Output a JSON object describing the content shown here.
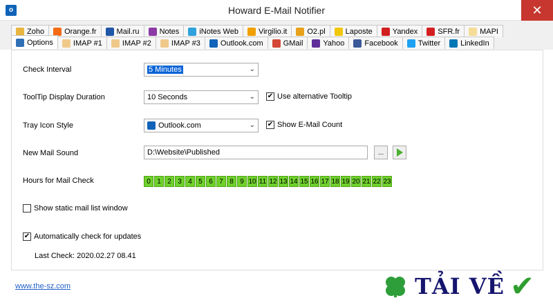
{
  "window": {
    "title": "Howard E-Mail Notifier",
    "close_symbol": "✕"
  },
  "tabs_row1": [
    {
      "label": "Zoho",
      "icon": "zoho-icon",
      "color": "#e8b53f"
    },
    {
      "label": "Orange.fr",
      "icon": "orange-icon",
      "color": "#f46b14"
    },
    {
      "label": "Mail.ru",
      "icon": "mailru-icon",
      "color": "#1f56a8"
    },
    {
      "label": "Notes",
      "icon": "notes-icon",
      "color": "#8c3aa5"
    },
    {
      "label": "iNotes Web",
      "icon": "inotes-icon",
      "color": "#2fa1dd"
    },
    {
      "label": "Virgilio.it",
      "icon": "virgilio-icon",
      "color": "#f0a000"
    },
    {
      "label": "O2.pl",
      "icon": "o2-icon",
      "color": "#e8a11a"
    },
    {
      "label": "Laposte",
      "icon": "laposte-icon",
      "color": "#f2c60a"
    },
    {
      "label": "Yandex",
      "icon": "yandex-icon",
      "color": "#d11f1f"
    },
    {
      "label": "SFR.fr",
      "icon": "sfr-icon",
      "color": "#d31f1f"
    },
    {
      "label": "MAPI",
      "icon": "mapi-icon",
      "color": "#f5dd97"
    }
  ],
  "tabs_row2": [
    {
      "label": "Options",
      "icon": "options-icon",
      "color": "#2f6fb5",
      "active": true
    },
    {
      "label": "IMAP #1",
      "icon": "envelope-icon",
      "color": "#f0c98a"
    },
    {
      "label": "IMAP #2",
      "icon": "envelope-icon",
      "color": "#f0c98a"
    },
    {
      "label": "IMAP #3",
      "icon": "envelope-icon",
      "color": "#f0c98a"
    },
    {
      "label": "Outlook.com",
      "icon": "outlook-icon",
      "color": "#0f63b8"
    },
    {
      "label": "GMail",
      "icon": "gmail-icon",
      "color": "#d34836"
    },
    {
      "label": "Yahoo",
      "icon": "yahoo-icon",
      "color": "#5f2d9a"
    },
    {
      "label": "Facebook",
      "icon": "facebook-icon",
      "color": "#3b5998"
    },
    {
      "label": "Twitter",
      "icon": "twitter-icon",
      "color": "#1da1f2"
    },
    {
      "label": "LinkedIn",
      "icon": "linkedin-icon",
      "color": "#0077b5"
    }
  ],
  "options": {
    "check_interval": {
      "label": "Check Interval",
      "value": "5 Minutes"
    },
    "tooltip_duration": {
      "label": "ToolTip Display Duration",
      "value": "10 Seconds"
    },
    "alt_tooltip": {
      "label": "Use alternative Tooltip",
      "checked": true
    },
    "tray_icon": {
      "label": "Tray Icon Style",
      "value": "Outlook.com",
      "icon": "outlook-icon"
    },
    "show_count": {
      "label": "Show E-Mail Count",
      "checked": true
    },
    "sound": {
      "label": "New Mail Sound",
      "value": "D:\\Website\\Published",
      "browse": "..."
    },
    "hours": {
      "label": "Hours for Mail Check",
      "values": [
        "0",
        "1",
        "2",
        "3",
        "4",
        "5",
        "6",
        "7",
        "8",
        "9",
        "10",
        "11",
        "12",
        "13",
        "14",
        "15",
        "16",
        "17",
        "18",
        "19",
        "20",
        "21",
        "22",
        "23"
      ],
      "color": "#6fd12c"
    },
    "static_list": {
      "label": "Show static mail list window",
      "checked": false
    },
    "auto_update": {
      "label": "Automatically check for updates",
      "checked": true
    },
    "last_check": "Last Check: 2020.02.27 08.41"
  },
  "footer": {
    "link": "www.the-sz.com"
  },
  "watermark": {
    "text": "TẢI VỀ",
    "check": "✔"
  },
  "glyphs": {
    "check": "✔",
    "arrow": "⌄",
    "app_icon_letter": "o"
  }
}
